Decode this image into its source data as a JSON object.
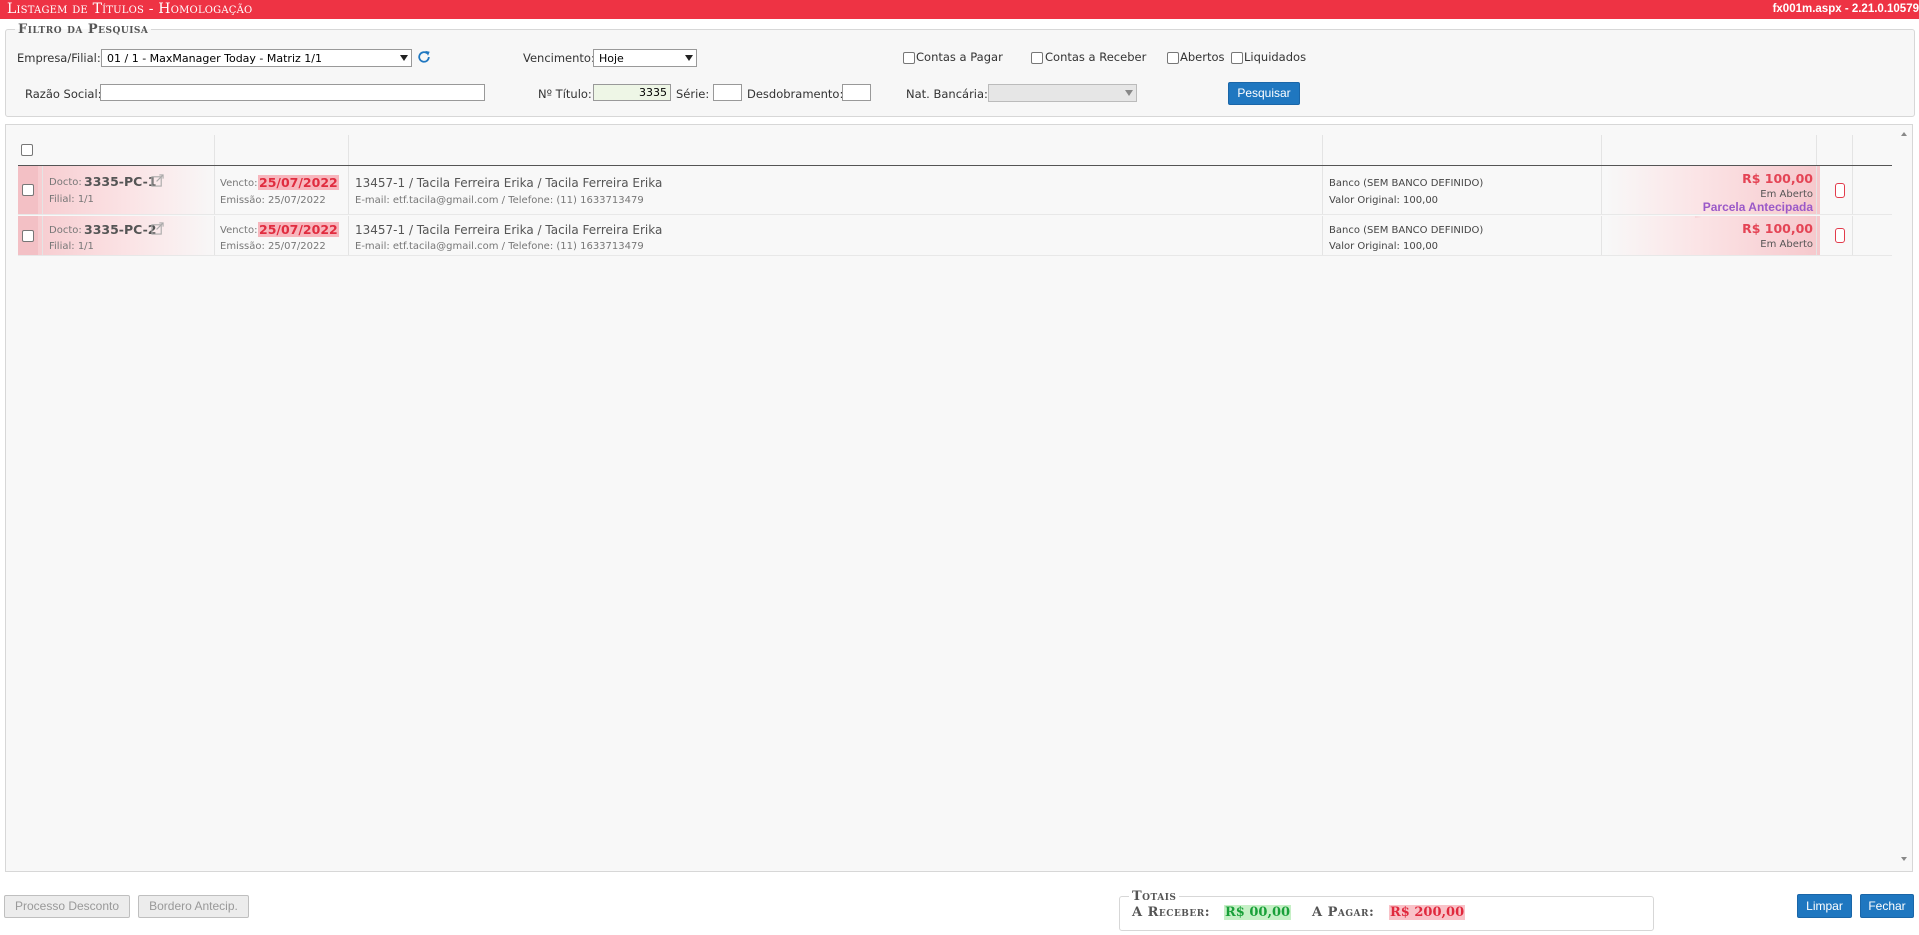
{
  "titlebar": {
    "title": "Listagem de Títulos  - Homologação",
    "version": "fx001m.aspx - 2.21.0.10579"
  },
  "filter": {
    "legend": "Filtro da Pesquisa",
    "empresa_label": "Empresa/Filial:",
    "empresa_value": "01 / 1 - MaxManager Today - Matriz 1/1",
    "vencimento_label": "Vencimento:",
    "vencimento_value": "Hoje",
    "contas_pagar_label": "Contas a Pagar",
    "contas_receber_label": "Contas a Receber",
    "abertos_label": "Abertos",
    "liquidados_label": "Liquidados",
    "razao_label": "Razão Social:",
    "razao_value": "",
    "titulo_label": "Nº Título:",
    "titulo_value": "3335",
    "serie_label": "Série:",
    "serie_value": "",
    "desdobramento_label": "Desdobramento:",
    "desdobramento_value": "",
    "nat_bancaria_label": "Nat. Bancária:",
    "nat_bancaria_value": "",
    "search_button": "Pesquisar"
  },
  "rows": [
    {
      "docto_label": "Docto:",
      "docto": "3335-PC-1",
      "filial": "Filial: 1/1",
      "vencto_label": "Vencto:",
      "vencto": "25/07/2022",
      "emissao": "Emissão: 25/07/2022",
      "cliente": "13457-1 / Tacila Ferreira Erika / Tacila Ferreira Erika",
      "contato": "E-mail: etf.tacila@gmail.com / Telefone: (11) 1633713479",
      "banco": "Banco (SEM BANCO DEFINIDO)",
      "valor_original": "Valor Original: 100,00",
      "amount": "R$ 100,00",
      "status": "Em Aberto",
      "tag": "Parcela Antecipada"
    },
    {
      "docto_label": "Docto:",
      "docto": "3335-PC-2",
      "filial": "Filial: 1/1",
      "vencto_label": "Vencto:",
      "vencto": "25/07/2022",
      "emissao": "Emissão: 25/07/2022",
      "cliente": "13457-1 / Tacila Ferreira Erika / Tacila Ferreira Erika",
      "contato": "E-mail: etf.tacila@gmail.com / Telefone: (11) 1633713479",
      "banco": "Banco (SEM BANCO DEFINIDO)",
      "valor_original": "Valor Original: 100,00",
      "amount": "R$ 100,00",
      "status": "Em Aberto"
    }
  ],
  "footer": {
    "processo_desconto": "Processo Desconto",
    "bordero_antecip": "Bordero Antecip.",
    "totais_legend": "Totais",
    "receber_label": "A Receber:",
    "receber_value": "R$ 00,00",
    "pagar_label": "A Pagar:",
    "pagar_value": "R$ 200,00",
    "limpar": "Limpar",
    "fechar": "Fechar"
  },
  "icons": {
    "refresh": "refresh-icon",
    "external_link": "external-link-icon",
    "dropdown": "chevron-down-icon"
  },
  "colors": {
    "titlebar": "#ee3344",
    "primary_button": "#1f77c0",
    "amount_red": "#e44455",
    "tag_purple": "#9b59c8",
    "total_green": "#19a039",
    "total_red": "#e0293d"
  }
}
